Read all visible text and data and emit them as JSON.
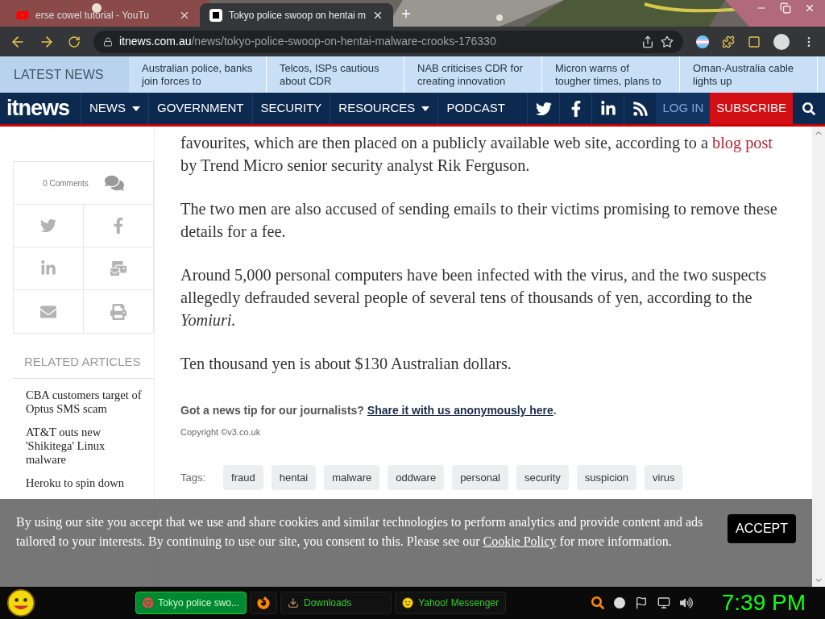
{
  "browser": {
    "tabs": [
      {
        "title": "erse cowel tutorial - YouTu",
        "kind": "youtube",
        "selected": false
      },
      {
        "title": "Tokyo police swoop on hentai m",
        "kind": "itnews",
        "selected": true
      }
    ],
    "url": {
      "domain": "itnews.com.au",
      "path": "/news/tokyo-police-swoop-on-hentai-malware-crooks-176330"
    }
  },
  "latest_news": {
    "label": "LATEST NEWS",
    "items": [
      "Australian police, banks join forces to",
      "Telcos, ISPs cautious about CDR",
      "NAB criticises CDR for creating innovation",
      "Micron warns of tougher times, plans to",
      "Oman-Australia cable lights up"
    ]
  },
  "nav": {
    "logo": "itnews",
    "items": [
      {
        "label": "NEWS",
        "dropdown": true
      },
      {
        "label": "GOVERNMENT",
        "dropdown": false
      },
      {
        "label": "SECURITY",
        "dropdown": false
      },
      {
        "label": "RESOURCES",
        "dropdown": true
      },
      {
        "label": "PODCAST",
        "dropdown": false
      }
    ],
    "login": "LOG IN",
    "subscribe": "SUBSCRIBE"
  },
  "sidebar": {
    "comments": "0 Comments",
    "related_heading": "RELATED ARTICLES",
    "related": [
      "CBA customers target of Optus SMS scam",
      "AT&T outs new 'Shikitega' Linux malware",
      "Heroku to spin down"
    ]
  },
  "article": {
    "paragraphs": [
      {
        "parts": [
          {
            "kind": "text",
            "text": "favourites, which are then placed on a publicly available web site, according to a "
          },
          {
            "kind": "link",
            "text": "blog post"
          },
          {
            "kind": "text",
            "text": " by Trend Micro senior security analyst Rik Ferguson."
          }
        ]
      },
      {
        "parts": [
          {
            "kind": "text",
            "text": "The two men are also accused of sending emails to their victims promising to remove these details for a fee."
          }
        ]
      },
      {
        "parts": [
          {
            "kind": "text",
            "text": "Around 5,000 personal computers have been infected with the virus, and the two suspects allegedly defrauded several people of several tens of thousands of yen, according to the *Yomiuri.*"
          }
        ]
      },
      {
        "parts": [
          {
            "kind": "text",
            "text": "Ten thousand yen is about $130 Australian dollars."
          }
        ]
      }
    ],
    "tip": {
      "text": "Got a news tip for our journalists?",
      "link": "Share it with us anonymously here",
      "after": "."
    },
    "copyright": "Copyright ©v3.co.uk",
    "tags_label": "Tags:",
    "tags": [
      "fraud",
      "hentai",
      "malware",
      "oddware",
      "personal",
      "security",
      "suspicion",
      "virus"
    ]
  },
  "cookie_banner": {
    "text": "By using our site you accept that we use and share cookies and similar technologies to perform analytics and provide content and ads tailored to your interests. By continuing to use our site, you consent to this. Please see our",
    "link": "Cookie Policy",
    "text_after": "for more information.",
    "button": "ACCEPT"
  },
  "taskbar": {
    "tasks": [
      {
        "kind": "chrome",
        "label": "Tokyo police swo...",
        "selected": true
      },
      {
        "kind": "firefox",
        "selected": false
      },
      {
        "kind": "downloads",
        "label": "Downloads",
        "selected": false
      },
      {
        "kind": "messenger",
        "label": "Yahoo! Messenger",
        "selected": false
      }
    ],
    "clock": "7:39 PM"
  }
}
